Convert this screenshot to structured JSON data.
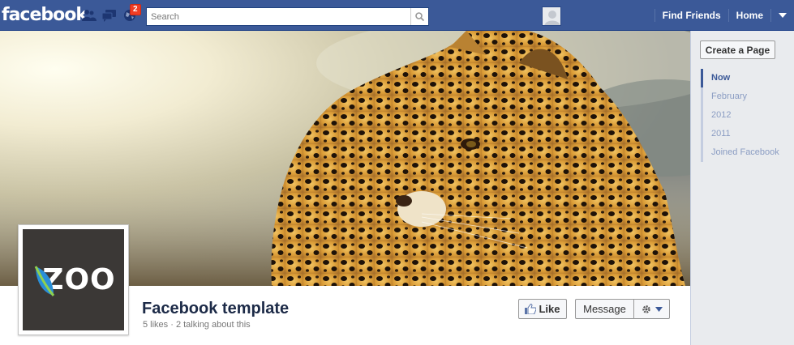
{
  "topbar": {
    "logo": "facebook",
    "notification_count": "2",
    "search_placeholder": "Search",
    "find_friends": "Find Friends",
    "home": "Home",
    "icons": [
      "friends-icon",
      "messages-icon",
      "notifications-globe-icon",
      "search-icon",
      "account-caret-icon"
    ]
  },
  "page": {
    "name": "Facebook template",
    "meta": "5 likes · 2 talking about this",
    "profile_text": "ZOO",
    "like_label": "Like",
    "message_label": "Message"
  },
  "sidebar": {
    "create_page": "Create a Page",
    "timeline": [
      "Now",
      "February",
      "2012",
      "2011",
      "Joined Facebook"
    ]
  },
  "colors": {
    "brand": "#3b5998",
    "profile_bg": "#3b3836"
  }
}
